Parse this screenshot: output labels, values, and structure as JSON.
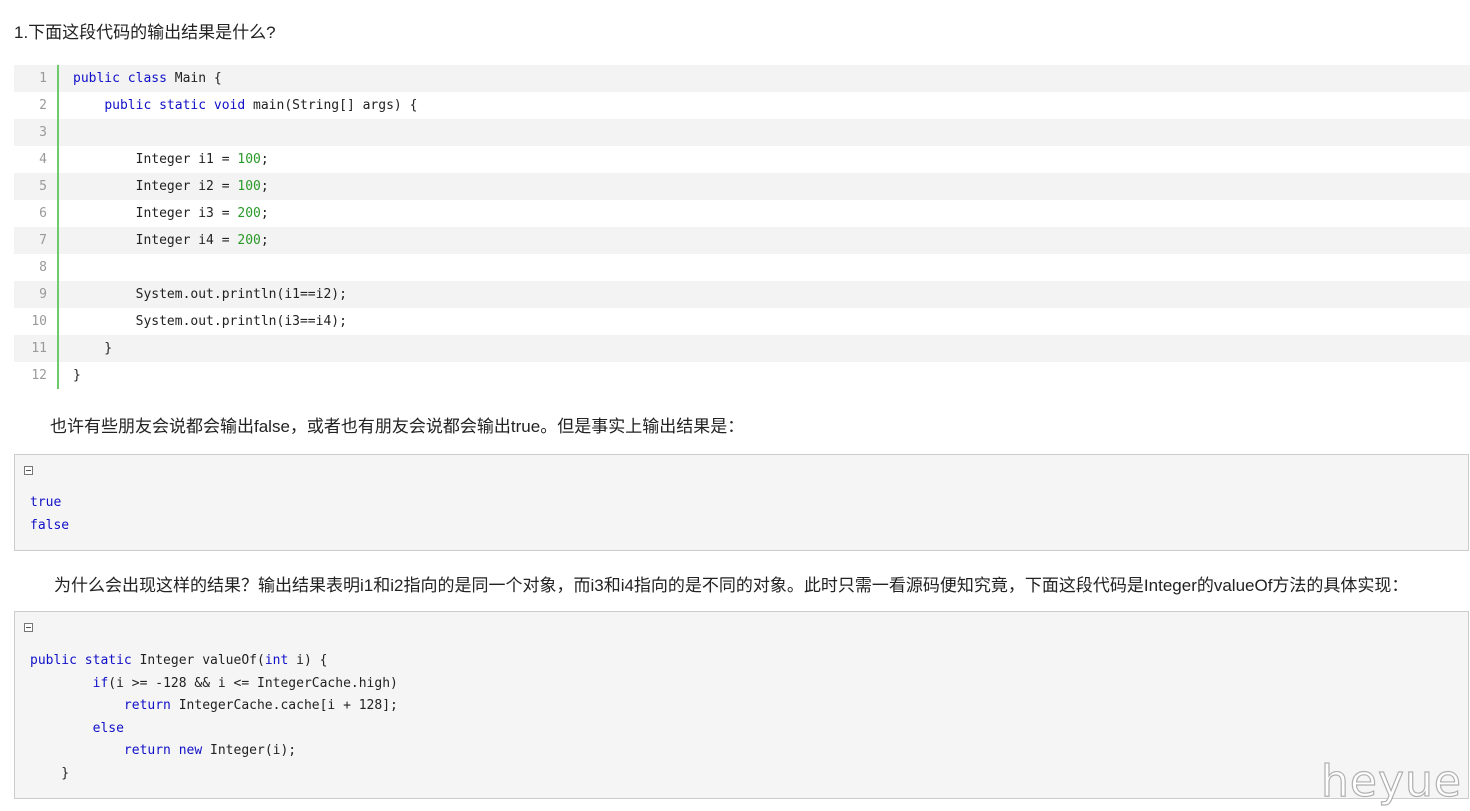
{
  "question": "1.下面这段代码的输出结果是什么?",
  "code1": {
    "lines": [
      {
        "n": "1",
        "parts": [
          {
            "t": "public class",
            "k": "kw"
          },
          {
            "t": " Main {",
            "k": ""
          }
        ]
      },
      {
        "n": "2",
        "parts": [
          {
            "t": "    ",
            "k": ""
          },
          {
            "t": "public static void",
            "k": "kw"
          },
          {
            "t": " main(String[] args) {",
            "k": ""
          }
        ]
      },
      {
        "n": "3",
        "parts": []
      },
      {
        "n": "4",
        "parts": [
          {
            "t": "        Integer i1 = ",
            "k": ""
          },
          {
            "t": "100",
            "k": "num"
          },
          {
            "t": ";",
            "k": ""
          }
        ]
      },
      {
        "n": "5",
        "parts": [
          {
            "t": "        Integer i2 = ",
            "k": ""
          },
          {
            "t": "100",
            "k": "num"
          },
          {
            "t": ";",
            "k": ""
          }
        ]
      },
      {
        "n": "6",
        "parts": [
          {
            "t": "        Integer i3 = ",
            "k": ""
          },
          {
            "t": "200",
            "k": "num"
          },
          {
            "t": ";",
            "k": ""
          }
        ]
      },
      {
        "n": "7",
        "parts": [
          {
            "t": "        Integer i4 = ",
            "k": ""
          },
          {
            "t": "200",
            "k": "num"
          },
          {
            "t": ";",
            "k": ""
          }
        ]
      },
      {
        "n": "8",
        "parts": []
      },
      {
        "n": "9",
        "parts": [
          {
            "t": "        System.out.println(i1==i2);",
            "k": ""
          }
        ]
      },
      {
        "n": "10",
        "parts": [
          {
            "t": "        System.out.println(i3==i4);",
            "k": ""
          }
        ]
      },
      {
        "n": "11",
        "parts": [
          {
            "t": "    }",
            "k": ""
          }
        ]
      },
      {
        "n": "12",
        "parts": [
          {
            "t": "}",
            "k": ""
          }
        ]
      }
    ]
  },
  "paragraph1": "也许有些朋友会说都会输出false，或者也有朋友会说都会输出true。但是事实上输出结果是：",
  "output_block": {
    "lines": [
      {
        "parts": [
          {
            "t": "true",
            "k": "out"
          }
        ]
      },
      {
        "parts": [
          {
            "t": "false",
            "k": "out"
          }
        ]
      }
    ]
  },
  "paragraph2": "为什么会出现这样的结果？输出结果表明i1和i2指向的是同一个对象，而i3和i4指向的是不同的对象。此时只需一看源码便知究竟，下面这段代码是Integer的valueOf方法的具体实现：",
  "code2": {
    "lines": [
      {
        "parts": [
          {
            "t": "public static",
            "k": "kw"
          },
          {
            "t": " Integer valueOf(",
            "k": ""
          },
          {
            "t": "int",
            "k": "kw"
          },
          {
            "t": " i) {",
            "k": ""
          }
        ]
      },
      {
        "parts": [
          {
            "t": "        ",
            "k": ""
          },
          {
            "t": "if",
            "k": "kw"
          },
          {
            "t": "(i >= -128 && i <= IntegerCache.high)",
            "k": ""
          }
        ]
      },
      {
        "parts": [
          {
            "t": "            ",
            "k": ""
          },
          {
            "t": "return",
            "k": "kw"
          },
          {
            "t": " IntegerCache.cache[i + 128];",
            "k": ""
          }
        ]
      },
      {
        "parts": [
          {
            "t": "        ",
            "k": ""
          },
          {
            "t": "else",
            "k": "kw"
          }
        ]
      },
      {
        "parts": [
          {
            "t": "            ",
            "k": ""
          },
          {
            "t": "return new",
            "k": "kw"
          },
          {
            "t": " Integer(i);",
            "k": ""
          }
        ]
      },
      {
        "parts": [
          {
            "t": "    }",
            "k": ""
          }
        ]
      }
    ]
  },
  "watermark": "heyue",
  "colors": {
    "keyword": "#1010c8",
    "number": "#2a9a2a",
    "gutter_border": "#6ccc6c",
    "stripe": "#f3f3f3"
  }
}
